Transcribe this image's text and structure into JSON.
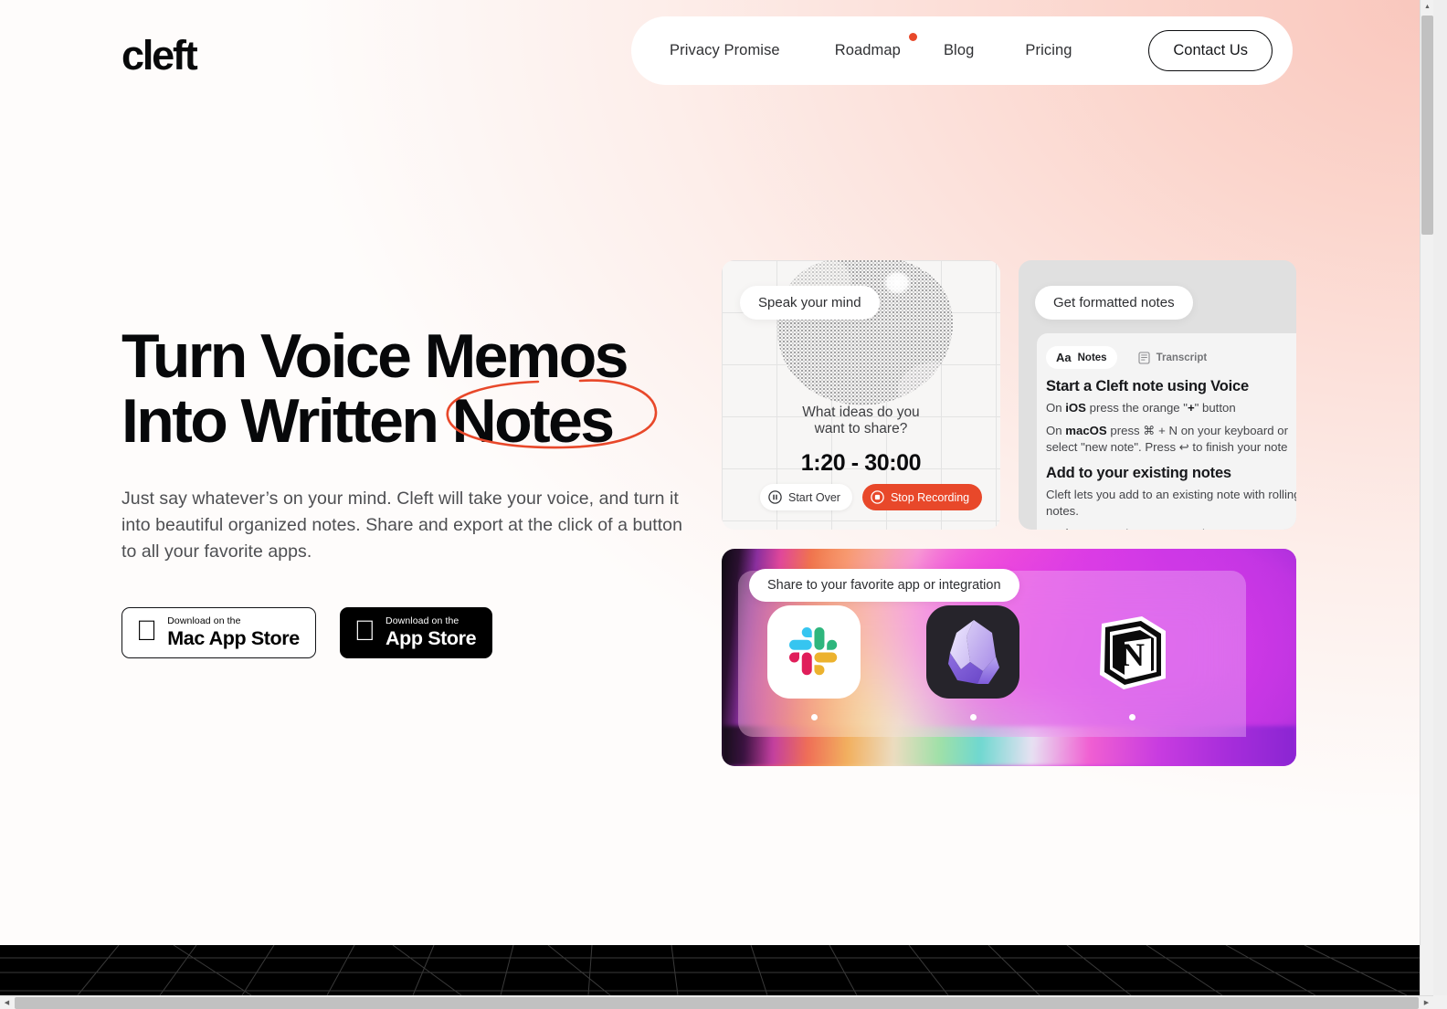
{
  "brand": {
    "logo": "cleft",
    "accent": "#e8482a",
    "ink": "#07080a"
  },
  "nav": {
    "items": [
      {
        "label": "Privacy Promise",
        "badge": false
      },
      {
        "label": "Roadmap",
        "badge": true
      },
      {
        "label": "Blog",
        "badge": false
      },
      {
        "label": "Pricing",
        "badge": false
      }
    ],
    "cta": "Contact Us"
  },
  "hero": {
    "headline_line1": "Turn Voice Memos",
    "headline_line2_before": "Into Written ",
    "headline_line2_circled": "Notes",
    "subhead": "Just say whatever’s on your mind. Cleft will take your voice, and turn it into beautiful organized notes. Share and export at the click of a button to all your favorite apps.",
    "stores": [
      {
        "small": "Download on the",
        "big": "Mac App Store",
        "style": "light"
      },
      {
        "small": "Download on the",
        "big": "App Store",
        "style": "dark"
      }
    ]
  },
  "record_card": {
    "pill": "Speak your mind",
    "prompt_line1": "What ideas do you",
    "prompt_line2": "want to share?",
    "timer": "1:20 - 30:00",
    "start_over": "Start Over",
    "stop_recording": "Stop Recording"
  },
  "notes_card": {
    "pill": "Get formatted notes",
    "tabs": [
      {
        "label": "Notes",
        "icon": "Aa",
        "active": true
      },
      {
        "label": "Transcript",
        "icon": "document-icon",
        "active": false
      }
    ],
    "blocks": [
      {
        "type": "heading",
        "text": "Start a Cleft note using Voice"
      },
      {
        "type": "paragraph",
        "html": "On <b>iOS</b> press the orange \"<b>+</b>\" button"
      },
      {
        "type": "paragraph",
        "html": "On <b>macOS</b> press ⌘ + N on your keyboard or select \"new note\". Press ↩ to finish your note"
      },
      {
        "type": "heading",
        "text": "Add to your existing notes"
      },
      {
        "type": "paragraph",
        "html": "Cleft lets you add to an existing note with rolling notes."
      },
      {
        "type": "paragraph",
        "html": "On <b>iOS</b> press the orange \"<b>+</b>\" button on an"
      }
    ]
  },
  "share_card": {
    "pill": "Share to your favorite app or integration",
    "apps": [
      {
        "name": "Slack"
      },
      {
        "name": "Obsidian"
      },
      {
        "name": "Notion"
      }
    ]
  }
}
